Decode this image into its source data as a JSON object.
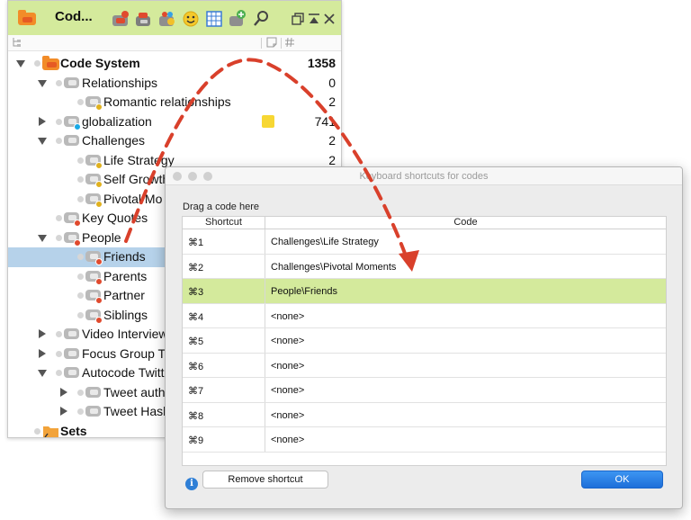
{
  "code_panel": {
    "title": "Cod...",
    "toolbar_icons": [
      "code-system-icon",
      "new-code-icon",
      "code-sets-icon",
      "color-code-icon",
      "emoticode-icon",
      "table-icon",
      "add-code-icon",
      "search-icon"
    ],
    "window_icons": [
      "restore-window-icon",
      "collapse-icon",
      "close-icon"
    ],
    "column_icons": [
      "tree-icon",
      "memo-column-icon",
      "hash-column-icon"
    ],
    "rows": [
      {
        "name": "Code System",
        "count": "1358",
        "level": 0,
        "twisty": "down",
        "bold": true,
        "root": true
      },
      {
        "name": "Relationships",
        "count": "0",
        "level": 1,
        "twisty": "down"
      },
      {
        "name": "Romantic relationships",
        "count": "2",
        "level": 2,
        "badge": "#e0b11e"
      },
      {
        "name": "globalization",
        "count": "741",
        "level": 1,
        "twisty": "right",
        "badge": "#19a9e6",
        "memo": true
      },
      {
        "name": "Challenges",
        "count": "2",
        "level": 1,
        "twisty": "down"
      },
      {
        "name": "Life Strategy",
        "count": "2",
        "level": 2,
        "badge": "#e0b11e"
      },
      {
        "name": "Self Growth",
        "count": "",
        "level": 2,
        "badge": "#e0b11e"
      },
      {
        "name": "Pivotal Mo",
        "count": "",
        "level": 2,
        "badge": "#e0b11e"
      },
      {
        "name": "Key Quotes",
        "count": "",
        "level": 1,
        "badge": "#e04a2e"
      },
      {
        "name": "People",
        "count": "",
        "level": 1,
        "twisty": "down",
        "badge": "#e04a2e"
      },
      {
        "name": "Friends",
        "count": "",
        "level": 2,
        "badge": "#e04a2e",
        "selected": true
      },
      {
        "name": "Parents",
        "count": "",
        "level": 2,
        "badge": "#e04a2e"
      },
      {
        "name": "Partner",
        "count": "",
        "level": 2,
        "badge": "#e04a2e"
      },
      {
        "name": "Siblings",
        "count": "",
        "level": 2,
        "badge": "#e04a2e"
      },
      {
        "name": "Video Interview",
        "count": "",
        "level": 1,
        "twisty": "right"
      },
      {
        "name": "Focus Group T",
        "count": "",
        "level": 1,
        "twisty": "right"
      },
      {
        "name": "Autocode Twitt",
        "count": "",
        "level": 1,
        "twisty": "down"
      },
      {
        "name": "Tweet auth",
        "count": "",
        "level": 2,
        "twisty": "right"
      },
      {
        "name": "Tweet Hash",
        "count": "",
        "level": 2,
        "twisty": "right"
      },
      {
        "name": "Sets",
        "count": "",
        "level": 0,
        "bold": true,
        "sets": true
      }
    ]
  },
  "dialog": {
    "title": "Keyboard shortcuts for codes",
    "drag_hint": "Drag a code here",
    "col_shortcut": "Shortcut",
    "col_code": "Code",
    "rows": [
      {
        "key": "⌘1",
        "code": "Challenges\\Life Strategy"
      },
      {
        "key": "⌘2",
        "code": "Challenges\\Pivotal Moments"
      },
      {
        "key": "⌘3",
        "code": "People\\Friends",
        "selected": true
      },
      {
        "key": "⌘4",
        "code": "<none>"
      },
      {
        "key": "⌘5",
        "code": "<none>"
      },
      {
        "key": "⌘6",
        "code": "<none>"
      },
      {
        "key": "⌘7",
        "code": "<none>"
      },
      {
        "key": "⌘8",
        "code": "<none>"
      },
      {
        "key": "⌘9",
        "code": "<none>"
      }
    ],
    "remove_label": "Remove shortcut",
    "ok_label": "OK",
    "info_glyph": "i"
  },
  "colors": {
    "toolbar_bg": "#d4ea9c",
    "selection_tree": "#b6d2ea",
    "selection_dialog": "#d4ea9c",
    "arrow": "#d9402b",
    "ok_button": "#1e6fd9"
  }
}
